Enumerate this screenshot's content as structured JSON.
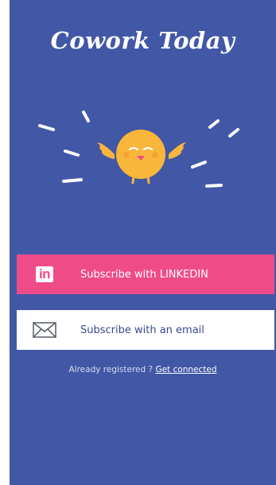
{
  "app": {
    "title": "Cowork Today"
  },
  "colors": {
    "background": "#4257a6",
    "linkedin_button": "#ef4c87",
    "email_button": "#ffffff",
    "mascot": "#f8b63a"
  },
  "actions": {
    "linkedin": {
      "label": "Subscribe with LINKEDIN",
      "icon": "linkedin-icon",
      "icon_text": "in"
    },
    "email": {
      "label": "Subscribe with an email",
      "icon": "envelope-icon"
    }
  },
  "login": {
    "prompt": "Already registered ?",
    "link": "Get connected"
  }
}
